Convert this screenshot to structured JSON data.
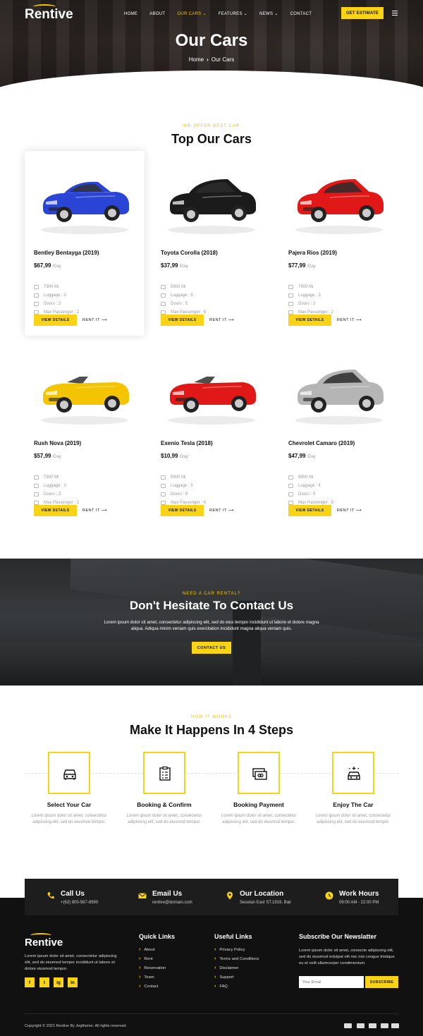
{
  "header": {
    "logo": "Rentive",
    "nav": [
      {
        "label": "HOME",
        "active": false,
        "dropdown": false
      },
      {
        "label": "ABOUT",
        "active": false,
        "dropdown": false
      },
      {
        "label": "OUR CARS",
        "active": true,
        "dropdown": true
      },
      {
        "label": "FEATURES",
        "active": false,
        "dropdown": true
      },
      {
        "label": "NEWS",
        "active": false,
        "dropdown": true
      },
      {
        "label": "CONTACT",
        "active": false,
        "dropdown": false
      }
    ],
    "cta_label": "GET ESTIMATE",
    "menu_icon": "hamburger-icon"
  },
  "hero": {
    "title": "Our Cars",
    "breadcrumb_home": "Home",
    "breadcrumb_sep": "›",
    "breadcrumb_current": "Our Cars"
  },
  "cars_section": {
    "eyebrow": "WE OFFER BEST CAR",
    "title": "Top Our Cars",
    "price_unit": "/Day",
    "details_label": "VIEW DETAILS",
    "rent_label": "RENT IT",
    "cars": [
      {
        "name": "Bentley Bentayga (2019)",
        "price": "$67,99",
        "mileage": "7900 Mi",
        "luggage": "Luggage : 3",
        "doors": "Doors : 2",
        "passenger": "Max Passenger : 2",
        "color": "#2a44d6",
        "body": "coupe"
      },
      {
        "name": "Toyota Corolla (2018)",
        "price": "$37,99",
        "mileage": "5900 Mi",
        "luggage": "Luggage : 5",
        "doors": "Doors : 5",
        "passenger": "Max Passenger : 6",
        "color": "#1b1b1b",
        "body": "hatch"
      },
      {
        "name": "Pajera Rios (2019)",
        "price": "$77,99",
        "mileage": "7900 Mi",
        "luggage": "Luggage : 3",
        "doors": "Doors : 2",
        "passenger": "Max Passenger : 2",
        "color": "#e01818",
        "body": "hatch"
      },
      {
        "name": "Rush Nova (2019)",
        "price": "$57,99",
        "mileage": "7900 Mi",
        "luggage": "Luggage : 3",
        "doors": "Doors : 2",
        "passenger": "Max Passenger : 2",
        "color": "#f5c400",
        "body": "convertible"
      },
      {
        "name": "Exenio Tesla (2018)",
        "price": "$10,99",
        "mileage": "5900 Mi",
        "luggage": "Luggage : 5",
        "doors": "Doors : 5",
        "passenger": "Max Passenger : 6",
        "color": "#e01818",
        "body": "convertible"
      },
      {
        "name": "Chevrolet Camaro (2019)",
        "price": "$47,99",
        "mileage": "6900 Mi",
        "luggage": "Luggage : 4",
        "doors": "Doors : 5",
        "passenger": "Max Passenger : 8",
        "color": "#b5b5b5",
        "body": "hatch"
      }
    ]
  },
  "contact_band": {
    "eyebrow": "NEED A CAR RENTAL?",
    "title": "Don't Hesitate To Contact Us",
    "text": "Lorem ipsum dolor sit amet, consectetur adipiscing elit, sed do eius tempor incididunt ut labore et dolore magna aliqua. Adiqua minim veniam quis exercitation incididunt magna aliqua veniam quis.",
    "button": "CONTACT US"
  },
  "steps": {
    "eyebrow": "HOW IT WORKS",
    "title": "Make It Happens In 4 Steps",
    "items": [
      {
        "title": "Select Your Car",
        "desc": "Lorem ipsum dolor sit amet, consectetur adipiscing elit, sed do eiusmod tempor.",
        "icon": "car-front-icon"
      },
      {
        "title": "Booking & Confirm",
        "desc": "Lorem ipsum dolor sit amet, consectetur adipiscing elit, sed do eiusmod tempor.",
        "icon": "clipboard-icon"
      },
      {
        "title": "Booking Payment",
        "desc": "Lorem ipsum dolor sit amet, consectetur adipiscing elit, sed do eiusmod tempor.",
        "icon": "payment-card-icon"
      },
      {
        "title": "Enjoy The Car",
        "desc": "Lorem ipsum dolor sit amet, consectetur adipiscing elit, sed do eiusmod tempor.",
        "icon": "sparkle-car-icon"
      }
    ]
  },
  "info_bar": [
    {
      "title": "Call Us",
      "sub": "+(62) 800-567-8990",
      "icon": "phone-icon"
    },
    {
      "title": "Email Us",
      "sub": "rentive@domain.com",
      "icon": "envelope-icon"
    },
    {
      "title": "Our Location",
      "sub": "Sesetan East ST.1919, Bali",
      "icon": "map-pin-icon"
    },
    {
      "title": "Work Hours",
      "sub": "09:00 AM - 22:00 PM",
      "icon": "clock-icon"
    }
  ],
  "footer": {
    "logo": "Rentive",
    "about": "Lorem ipsum dolor sit amet, consectetur adipiscing elit, sed do eiusmod tempor incididunt ut labore et dolore eiusmod tempor.",
    "social": [
      "f",
      "t",
      "ig",
      "in"
    ],
    "quick_links_title": "Quick Links",
    "quick_links": [
      "About",
      "Rent",
      "Reservation",
      "Team",
      "Contact"
    ],
    "useful_links_title": "Useful Links",
    "useful_links": [
      "Privacy Policy",
      "Terms and Conditions",
      "Disclaimer",
      "Support",
      "FAQ"
    ],
    "newsletter_title": "Subscribe Our Newslatter",
    "newsletter_text": "Lorem ipsum dolor sit amet, consecte adipiscing elit, sed do eiusmod volutpat elit nec nisi congue tristique eu et velit ullamcorper condimentum.",
    "newsletter_placeholder": "Your Email",
    "subscribe_label": "SUBSCRIBE",
    "copyright": "Copyright © 2021 Rentive By Jegtheme. All rights reserved.",
    "accent": "#f9d315"
  }
}
